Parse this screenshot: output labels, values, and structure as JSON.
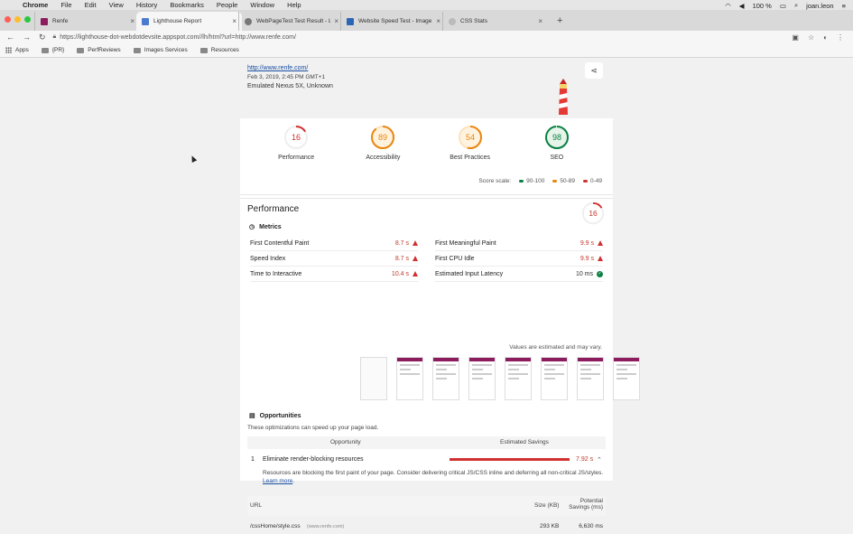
{
  "mac_menu": {
    "app": "Chrome",
    "items": [
      "File",
      "Edit",
      "View",
      "History",
      "Bookmarks",
      "People",
      "Window",
      "Help"
    ],
    "battery": "100 %",
    "user": "joan.leon"
  },
  "tabs": [
    {
      "title": "Renfe",
      "fav_color": "#8d1c5e"
    },
    {
      "title": "Lighthouse Report",
      "fav_color": "#4a7bd0",
      "active": true
    },
    {
      "title": "WebPageTest Test Result - L",
      "fav_color": "#777"
    },
    {
      "title": "Website Speed Test - Image A",
      "fav_color": "#2a66b5"
    },
    {
      "title": "CSS Stats",
      "fav_color": "#999"
    }
  ],
  "omnibox": {
    "url": "https://lighthouse-dot-webdotdevsite.appspot.com//lh/html?url=http://www.renfe.com/"
  },
  "bookmarks": [
    {
      "label": "Apps",
      "icon": "apps-grid-icon"
    },
    {
      "label": "{PR}",
      "icon": "folder-icon"
    },
    {
      "label": "PerfReviews",
      "icon": "folder-icon"
    },
    {
      "label": "Images Services",
      "icon": "folder-icon"
    },
    {
      "label": "Resources",
      "icon": "folder-icon"
    }
  ],
  "report": {
    "url": "http://www.renfe.com/",
    "date": "Feb 3, 2019, 2:45 PM GMT+1",
    "device": "Emulated Nexus 5X, Unknown",
    "gauges": [
      {
        "label": "Performance",
        "score": 16,
        "color": "#d23030"
      },
      {
        "label": "Accessibility",
        "score": 89,
        "color": "#e8870f"
      },
      {
        "label": "Best Practices",
        "score": 54,
        "color": "#e8870f"
      },
      {
        "label": "SEO",
        "score": 98,
        "color": "#0b8043"
      }
    ],
    "score_scale": {
      "label": "Score scale:",
      "ranges": [
        {
          "label": "90-100",
          "color": "#0b8043"
        },
        {
          "label": "50-89",
          "color": "#e8870f"
        },
        {
          "label": "0-49",
          "color": "#d23030"
        }
      ]
    },
    "performance": {
      "title": "Performance",
      "score": 16,
      "metrics_heading": "Metrics",
      "metrics_left": [
        {
          "name": "First Contentful Paint",
          "value": "8.7 s"
        },
        {
          "name": "Speed Index",
          "value": "8.7 s"
        },
        {
          "name": "Time to Interactive",
          "value": "10.4 s"
        }
      ],
      "metrics_right": [
        {
          "name": "First Meaningful Paint",
          "value": "9.9 s"
        },
        {
          "name": "First CPU Idle",
          "value": "9.9 s"
        },
        {
          "name": "Estimated Input Latency",
          "value": "10 ms"
        }
      ],
      "values_note": "Values are estimated and may vary."
    },
    "opportunities": {
      "heading": "Opportunities",
      "description": "These optimizations can speed up your page load.",
      "col_opportunity": "Opportunity",
      "col_savings": "Estimated Savings",
      "items": [
        {
          "num": "1",
          "title": "Eliminate render-blocking resources",
          "savings": "7.92 s",
          "fraction": 1.0
        }
      ],
      "detail_text": "Resources are blocking the first paint of your page. Consider delivering critical JS/CSS inline and deferring all non-critical JS/styles.",
      "learn_more": "Learn more",
      "table": {
        "col_url": "URL",
        "col_size": "Size (KB)",
        "col_potential_1": "Potential",
        "col_potential_2": "Savings (ms)",
        "rows": [
          {
            "url": "/cssHome/style.css",
            "host": "(www.renfe.com)",
            "size": "293 KB",
            "savings": "6,630 ms"
          }
        ]
      }
    }
  }
}
